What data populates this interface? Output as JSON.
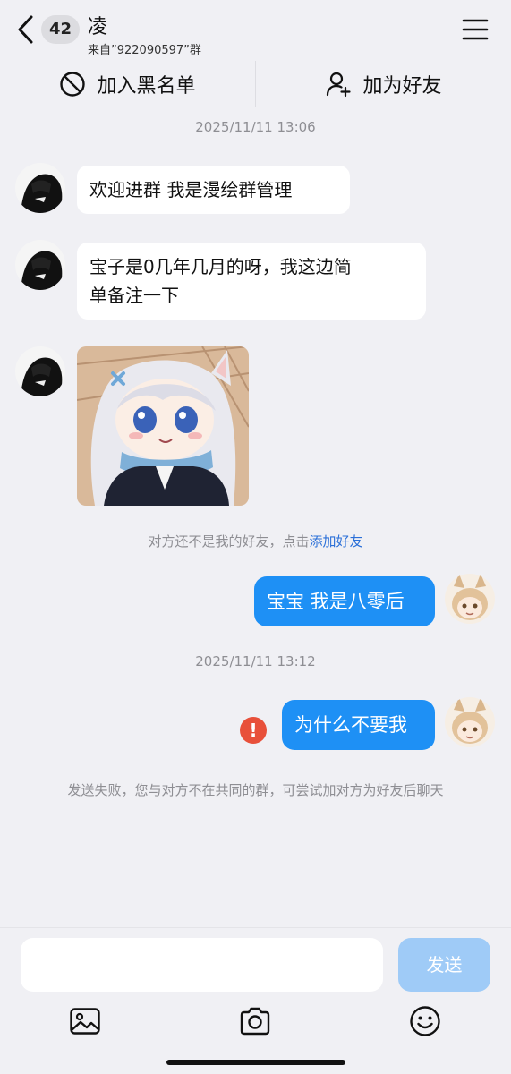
{
  "header": {
    "unread_count": "42",
    "contact_name": "凌",
    "source": "来自”922090597”群"
  },
  "actions": {
    "block_label": "加入黑名单",
    "add_friend_label": "加为好友"
  },
  "messages": {
    "timestamp_1": "2025/11/11 13:06",
    "incoming_1": "欢迎进群  我是漫绘群管理",
    "incoming_2_line1": "宝子是0几年几月的呀，我这边简",
    "incoming_2_line2": "单备注一下",
    "friend_notice_prefix": "对方还不是我的好友，点击",
    "friend_notice_link": "添加好友",
    "outgoing_1": "宝宝 我是八零后",
    "timestamp_2": "2025/11/11 13:12",
    "outgoing_2": "为什么不要我",
    "error_mark": "!",
    "failed_notice": "发送失败，您与对方不在共同的群，可尝试加对方为好友后聊天"
  },
  "composer": {
    "input_value": "",
    "send_label": "发送"
  },
  "icons": {
    "back": "chevron-left-icon",
    "menu": "hamburger-menu-icon",
    "block": "block-icon",
    "add_friend": "add-user-icon",
    "image": "image-icon",
    "camera": "camera-icon",
    "emoji": "emoji-icon"
  },
  "colors": {
    "background": "#f0f0f4",
    "outgoing_bubble": "#1e90f5",
    "send_button_disabled": "#9fcbf7",
    "error": "#e8503a",
    "link": "#2a6fd8"
  }
}
